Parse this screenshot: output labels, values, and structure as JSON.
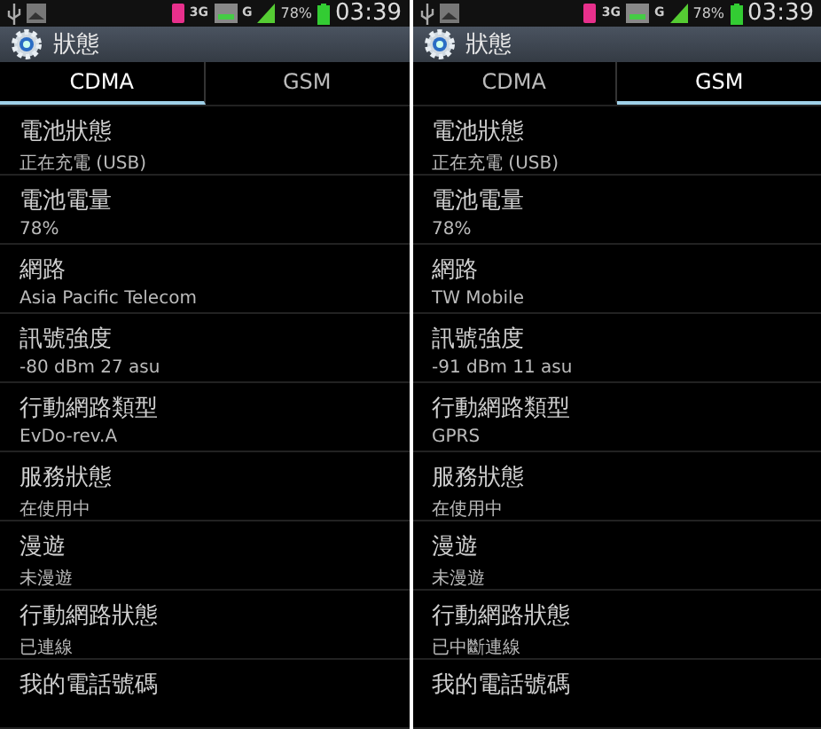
{
  "screens": [
    {
      "status_bar": {
        "network": "3G",
        "network_2": "G",
        "battery": "78%",
        "time": "03:39"
      },
      "title": "狀態",
      "tabs": [
        {
          "label": "CDMA",
          "selected": true
        },
        {
          "label": "GSM",
          "selected": false
        }
      ],
      "rows": [
        {
          "title": "電池狀態",
          "value": "正在充電 (USB)"
        },
        {
          "title": "電池電量",
          "value": "78%"
        },
        {
          "title": "網路",
          "value": "Asia Pacific Telecom"
        },
        {
          "title": "訊號強度",
          "value": "-80 dBm   27 asu"
        },
        {
          "title": "行動網路類型",
          "value": "EvDo-rev.A"
        },
        {
          "title": "服務狀態",
          "value": "在使用中"
        },
        {
          "title": "漫遊",
          "value": "未漫遊"
        },
        {
          "title": "行動網路狀態",
          "value": "已連線"
        },
        {
          "title": "我的電話號碼"
        }
      ]
    },
    {
      "status_bar": {
        "network": "3G",
        "network_2": "G",
        "battery": "78%",
        "time": "03:39"
      },
      "title": "狀態",
      "tabs": [
        {
          "label": "CDMA",
          "selected": false
        },
        {
          "label": "GSM",
          "selected": true
        }
      ],
      "rows": [
        {
          "title": "電池狀態",
          "value": "正在充電 (USB)"
        },
        {
          "title": "電池電量",
          "value": "78%"
        },
        {
          "title": "網路",
          "value": "TW Mobile"
        },
        {
          "title": "訊號強度",
          "value": "-91 dBm   11 asu"
        },
        {
          "title": "行動網路類型",
          "value": "GPRS"
        },
        {
          "title": "服務狀態",
          "value": "在使用中"
        },
        {
          "title": "漫遊",
          "value": "未漫遊"
        },
        {
          "title": "行動網路狀態",
          "value": "已中斷連線"
        },
        {
          "title": "我的電話號碼"
        }
      ]
    }
  ]
}
